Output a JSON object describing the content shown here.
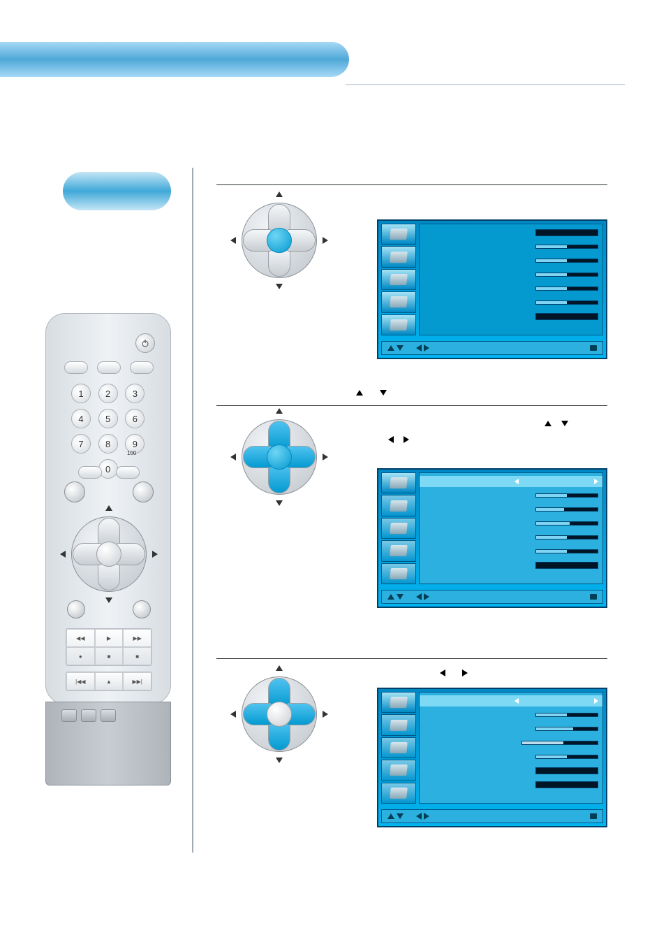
{
  "header": {
    "title": ""
  },
  "remote": {
    "numbers": [
      "1",
      "2",
      "3",
      "4",
      "5",
      "6",
      "7",
      "8",
      "9",
      "",
      "0",
      ""
    ],
    "hundred_label": "100",
    "transport1": [
      "◀◀",
      "▶",
      "▶▶",
      "●",
      "■",
      "■"
    ],
    "transport2": [
      "|◀◀",
      "▲",
      "▶▶|"
    ]
  },
  "steps": [
    {
      "dpad": {
        "center": "blue",
        "highlight": []
      },
      "osd": {
        "sidebar_active": 0,
        "content_style": "dark",
        "rows": [
          {
            "type": "value",
            "value": ""
          },
          {
            "type": "slider",
            "fill": 50
          },
          {
            "type": "slider",
            "fill": 50
          },
          {
            "type": "slider",
            "fill": 50
          },
          {
            "type": "slider",
            "fill": 50
          },
          {
            "type": "slider",
            "fill": 50
          },
          {
            "type": "value",
            "value": ""
          }
        ],
        "hints": [
          "",
          "",
          ""
        ]
      }
    },
    {
      "dpad": {
        "center": "blue",
        "highlight": [
          "up",
          "down",
          "left",
          "right"
        ]
      },
      "triangles_top": [
        "up",
        "down"
      ],
      "triangles_sub": [
        "left",
        "right"
      ],
      "triangles_tail": [
        "up",
        "down"
      ],
      "osd": {
        "sidebar_active": 0,
        "inactive_tabs": true,
        "content_style": "light",
        "rows": [
          {
            "type": "selected_value",
            "value": ""
          },
          {
            "type": "slider",
            "fill": 50
          },
          {
            "type": "slider",
            "fill": 45
          },
          {
            "type": "slider",
            "fill": 55
          },
          {
            "type": "slider",
            "fill": 50
          },
          {
            "type": "slider",
            "fill": 50
          },
          {
            "type": "value",
            "value": ""
          }
        ],
        "hints": [
          "",
          "",
          ""
        ]
      }
    },
    {
      "dpad": {
        "center": "silver",
        "highlight": [
          "up",
          "down",
          "left",
          "right"
        ]
      },
      "triangles_top": [
        "left",
        "right"
      ],
      "osd": {
        "sidebar_active": 0,
        "inactive_tabs": true,
        "content_style": "light",
        "rows": [
          {
            "type": "selected_value",
            "value": ""
          },
          {
            "type": "slider",
            "fill": 50
          },
          {
            "type": "slider",
            "fill": 60
          },
          {
            "type": "slider2",
            "fill": 55
          },
          {
            "type": "slider",
            "fill": 50
          },
          {
            "type": "value",
            "value": ""
          },
          {
            "type": "value",
            "value": ""
          }
        ],
        "hints": [
          "",
          "",
          ""
        ]
      }
    }
  ]
}
